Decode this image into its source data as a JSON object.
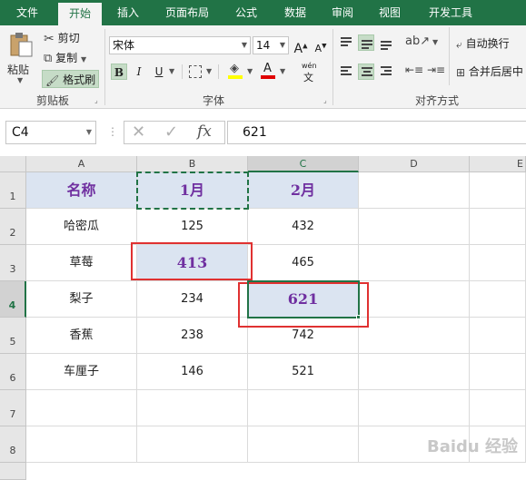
{
  "tabs": [
    "文件",
    "开始",
    "插入",
    "页面布局",
    "公式",
    "数据",
    "审阅",
    "视图",
    "开发工具"
  ],
  "ribbon": {
    "clipboard": {
      "paste": "粘贴",
      "cut": "剪切",
      "copy": "复制",
      "format_painter": "格式刷",
      "label": "剪贴板"
    },
    "font": {
      "name": "宋体",
      "size": "14",
      "bold": "B",
      "italic": "I",
      "underline": "U",
      "wen": "wén",
      "label": "字体"
    },
    "alignment": {
      "wrap": "自动换行",
      "merge": "合并后居中",
      "label": "对齐方式"
    }
  },
  "formula_bar": {
    "name_box": "C4",
    "fx": "fx",
    "value": "621"
  },
  "columns": [
    "A",
    "B",
    "C",
    "D",
    "E"
  ],
  "rows": [
    "1",
    "2",
    "3",
    "4",
    "5",
    "6",
    "7",
    "8"
  ],
  "cells": {
    "A1": "名称",
    "B1": "1月",
    "C1": "2月",
    "A2": "哈密瓜",
    "B2": "125",
    "C2": "432",
    "A3": "草莓",
    "B3": "413",
    "C3": "465",
    "A4": "梨子",
    "B4": "234",
    "C4": "621",
    "A5": "香蕉",
    "B5": "238",
    "C5": "742",
    "A6": "车厘子",
    "B6": "146",
    "C6": "521"
  },
  "watermark": "Baidu 经验",
  "colors": {
    "accent": "#217346",
    "header_fill": "#dbe4f1",
    "header_text": "#7030a0",
    "highlight_box": "#e03131"
  }
}
